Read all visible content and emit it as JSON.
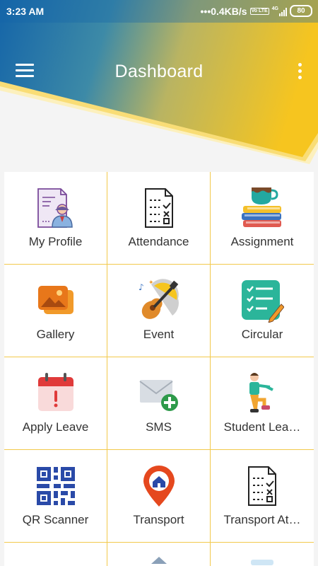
{
  "status_bar": {
    "time": "3:23 AM",
    "net_speed": "•••0.4KB/s",
    "volte": "Vo LTE",
    "signal": "4G",
    "battery": "80"
  },
  "toolbar": {
    "title": "Dashboard",
    "menu_icon": "hamburger-menu-icon",
    "more_icon": "more-vertical-icon"
  },
  "colors": {
    "header_blue": "#1565a8",
    "header_yellow": "#f6c51f",
    "grid_line": "#f2c94c",
    "label_text": "#333333"
  },
  "tiles": [
    {
      "label": "My Profile",
      "icon": "profile-icon"
    },
    {
      "label": "Attendance",
      "icon": "checklist-icon"
    },
    {
      "label": "Assignment",
      "icon": "books-cup-icon"
    },
    {
      "label": "Gallery",
      "icon": "gallery-icon"
    },
    {
      "label": "Event",
      "icon": "guitar-icon"
    },
    {
      "label": "Circular",
      "icon": "circular-list-icon"
    },
    {
      "label": "Apply Leave",
      "icon": "calendar-alert-icon"
    },
    {
      "label": "SMS",
      "icon": "sms-envelope-icon"
    },
    {
      "label": "Student Lea…",
      "icon": "student-walking-icon"
    },
    {
      "label": "QR Scanner",
      "icon": "qr-code-icon"
    },
    {
      "label": "Transport",
      "icon": "location-pin-icon"
    },
    {
      "label": "Transport At…",
      "icon": "transport-checklist-icon"
    }
  ]
}
